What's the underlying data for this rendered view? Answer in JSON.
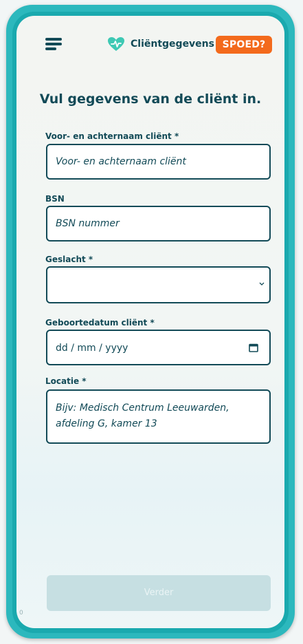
{
  "header": {
    "title": "Cliëntgegevens",
    "spoed_label": "SPOED?",
    "brand_icon": "heart-check-icon",
    "menu_icon": "hamburger-menu-icon"
  },
  "page": {
    "title": "Vul gegevens van de cliënt in."
  },
  "form": {
    "name": {
      "label": "Voor- en achternaam cliënt *",
      "placeholder": "Voor- en achternaam cliënt",
      "value": ""
    },
    "bsn": {
      "label": "BSN",
      "placeholder": "BSN nummer",
      "value": ""
    },
    "gender": {
      "label": "Geslacht *",
      "selected": ""
    },
    "birthdate": {
      "label": "Geboortedatum cliënt *",
      "placeholder": "dd / mm / yyyy"
    },
    "location": {
      "label": "Locatie *",
      "placeholder": "Bijv: Medisch Centrum Leeuwarden, afdeling G, kamer 13"
    }
  },
  "footer": {
    "next_label": "Verder",
    "corner_mark": "0"
  },
  "colors": {
    "frame": "#2cb8bd",
    "primary": "#124a57",
    "accent": "#f36a1c",
    "heart": "#3ec9b4",
    "button_disabled": "#c6dfe2"
  }
}
